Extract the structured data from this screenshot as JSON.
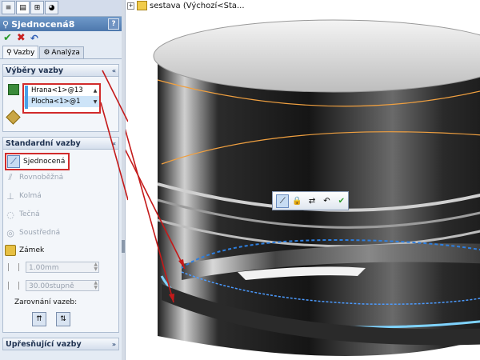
{
  "feature_title": "Sjednocená8",
  "help_label": "?",
  "actions": {
    "ok": "✔",
    "cancel": "✖",
    "undo": "↶"
  },
  "tabs": {
    "mates": "Vazby",
    "analysis": "Analýza"
  },
  "selections": {
    "header": "Výběry vazby",
    "items": [
      "Hrana<1>@13",
      "Plocha<1>@1"
    ]
  },
  "standard": {
    "header": "Standardní vazby",
    "coincident": "Sjednocená",
    "parallel": "Rovnoběžná",
    "perpendicular": "Kolmá",
    "tangent": "Tečná",
    "concentric": "Soustředná",
    "lock": "Zámek",
    "distance": "1.00mm",
    "angle": "30.00stupně",
    "alignment_label": "Zarovnání vazeb:"
  },
  "advanced": {
    "header": "Upřesňující vazby"
  },
  "tree": {
    "label": "sestava  (Výchozí<Sta..."
  },
  "collapse_glyph": "«",
  "expand_glyph": "»",
  "colors": {
    "accent": "#4d78ad",
    "highlight_red": "#d12b2b",
    "selection_blue": "#4aa0e8",
    "edge_orange": "#f0a040"
  }
}
